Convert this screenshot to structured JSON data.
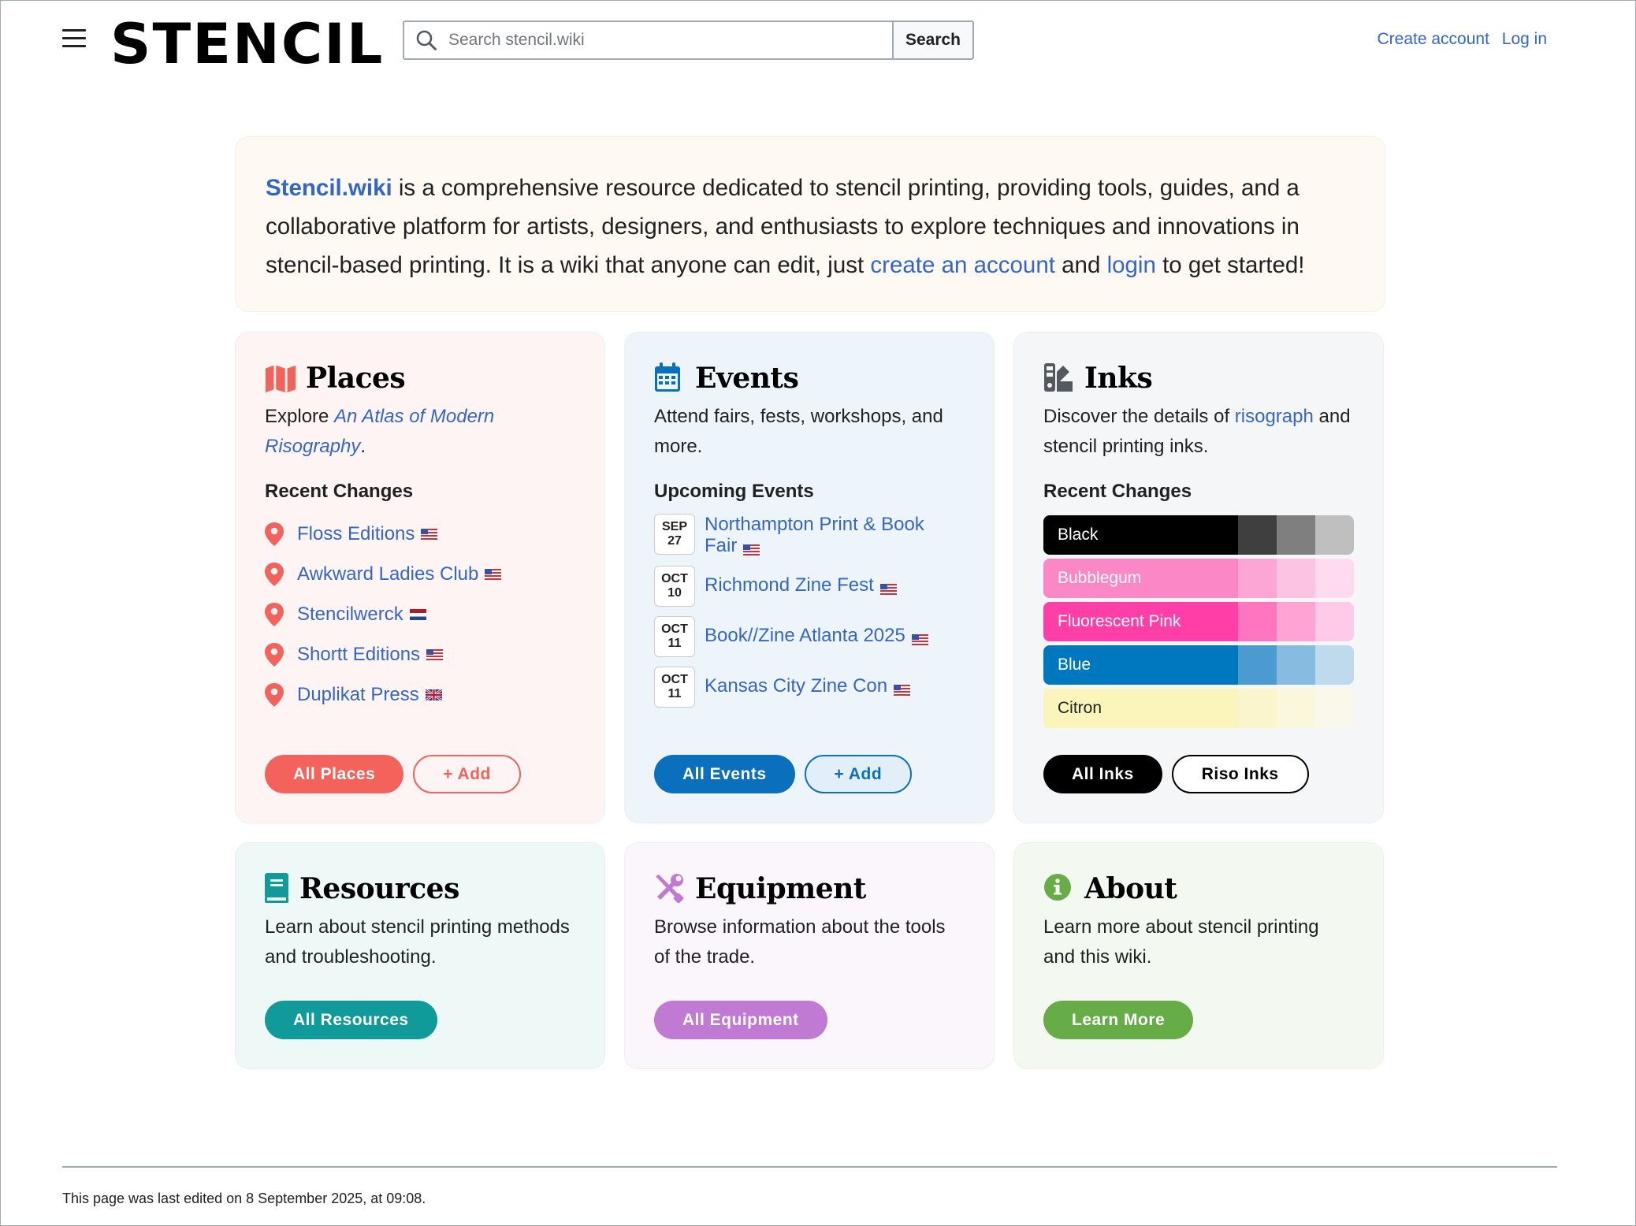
{
  "header": {
    "logo": "STENCIL",
    "search_placeholder": "Search stencil.wiki",
    "search_button": "Search",
    "create_account": "Create account",
    "login": "Log in"
  },
  "intro": {
    "brand": "Stencil.wiki",
    "text1": " is a comprehensive resource dedicated to stencil printing, providing tools, guides, and a collaborative platform for artists, designers, and enthusiasts to explore techniques and innovations in stencil-based printing. It is a wiki that anyone can edit, just ",
    "link_account": "create an account",
    "text2": " and ",
    "link_login": "login",
    "text3": " to get started!"
  },
  "places": {
    "title": "Places",
    "desc_prefix": "Explore ",
    "desc_link": "An Atlas of Modern Risography",
    "desc_suffix": ".",
    "subheading": "Recent Changes",
    "items": [
      {
        "name": "Floss Editions",
        "flag": "us"
      },
      {
        "name": "Awkward Ladies Club",
        "flag": "us"
      },
      {
        "name": "Stencilwerck",
        "flag": "nl"
      },
      {
        "name": "Shortt Editions",
        "flag": "us"
      },
      {
        "name": "Duplikat Press",
        "flag": "gb"
      }
    ],
    "btn_all": "All Places",
    "btn_add": "+ Add",
    "accent": "#f4625c"
  },
  "events": {
    "title": "Events",
    "desc": "Attend fairs, fests, workshops, and more.",
    "subheading": "Upcoming Events",
    "items": [
      {
        "month": "SEP",
        "day": "27",
        "name": "Northampton Print & Book Fair",
        "flag": "us"
      },
      {
        "month": "OCT",
        "day": "10",
        "name": "Richmond Zine Fest",
        "flag": "us"
      },
      {
        "month": "OCT",
        "day": "11",
        "name": "Book//Zine Atlanta 2025",
        "flag": "us"
      },
      {
        "month": "OCT",
        "day": "11",
        "name": "Kansas City Zine Con",
        "flag": "us"
      }
    ],
    "btn_all": "All Events",
    "btn_add": "+ Add",
    "accent": "#0a70bd"
  },
  "inks": {
    "title": "Inks",
    "desc_prefix": "Discover the details of ",
    "desc_link": "risograph",
    "desc_suffix": " and stencil printing inks.",
    "subheading": "Recent Changes",
    "items": [
      {
        "name": "Black",
        "color": "#000000",
        "text": "#ffffff",
        "tints": [
          "#3f3f3f",
          "#7f7f7f",
          "#bfbfbf"
        ]
      },
      {
        "name": "Bubblegum",
        "color": "#fb87c7",
        "text": "#ffffff",
        "tints": [
          "#fca6d5",
          "#fdc3e3",
          "#fedbee"
        ]
      },
      {
        "name": "Fluorescent Pink",
        "color": "#ff3ea8",
        "text": "#ffffff",
        "tints": [
          "#ff76bf",
          "#ffa2d4",
          "#ffcae7"
        ]
      },
      {
        "name": "Blue",
        "color": "#0078bf",
        "text": "#ffffff",
        "tints": [
          "#4b9ad0",
          "#87bce0",
          "#bfdaec"
        ]
      },
      {
        "name": "Citron",
        "color": "#fbf5bb",
        "text": "#202122",
        "tints": [
          "#fbf5cd",
          "#fbf7dc",
          "#faf8ea"
        ]
      }
    ],
    "btn_all": "All Inks",
    "btn_riso": "Riso Inks"
  },
  "resources": {
    "title": "Resources",
    "desc": "Learn about stencil printing methods and troubleshooting.",
    "btn": "All Resources",
    "accent": "#119a9a"
  },
  "equipment": {
    "title": "Equipment",
    "desc": "Browse information about the tools of the trade.",
    "btn": "All Equipment",
    "accent": "#c07ad3"
  },
  "about": {
    "title": "About",
    "desc": "Learn more about stencil printing and this wiki.",
    "btn": "Learn More",
    "accent": "#66ac47"
  },
  "footer": {
    "last_edited": "This page was last edited on 8 September 2025, at 09:08."
  }
}
